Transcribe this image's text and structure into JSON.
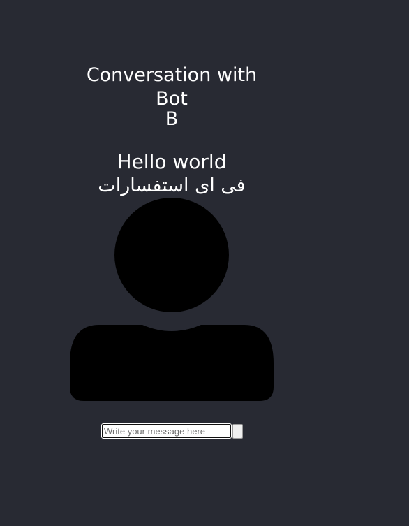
{
  "conversation": {
    "title": "Conversation with Bot",
    "bot_initial": "B"
  },
  "messages": [
    {
      "text": "Hello world"
    },
    {
      "text": "فی ای استفسارات"
    }
  ],
  "avatar": {
    "icon": "user-icon",
    "color": "#000000"
  },
  "composer": {
    "value": "",
    "placeholder": "Write your message here",
    "send_label": ""
  },
  "colors": {
    "background": "#282a33",
    "text": "#ffffff"
  }
}
